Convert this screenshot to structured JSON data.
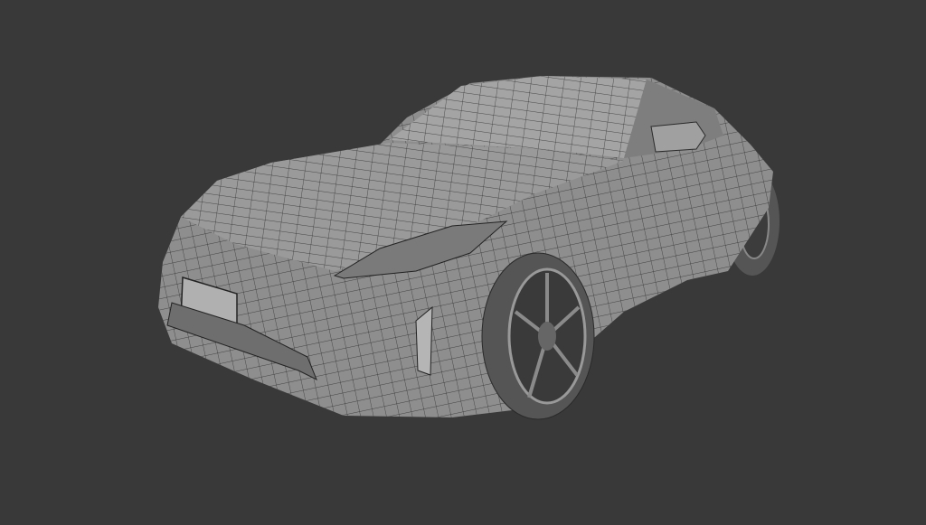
{
  "viewport": {
    "background_color": "#393939",
    "body_color": "#8e8e8e",
    "body_light_color": "#a4a4a4",
    "wire_color": "#2a2a2a",
    "tire_color": "#555555",
    "rim_color": "#6a6a6a"
  }
}
